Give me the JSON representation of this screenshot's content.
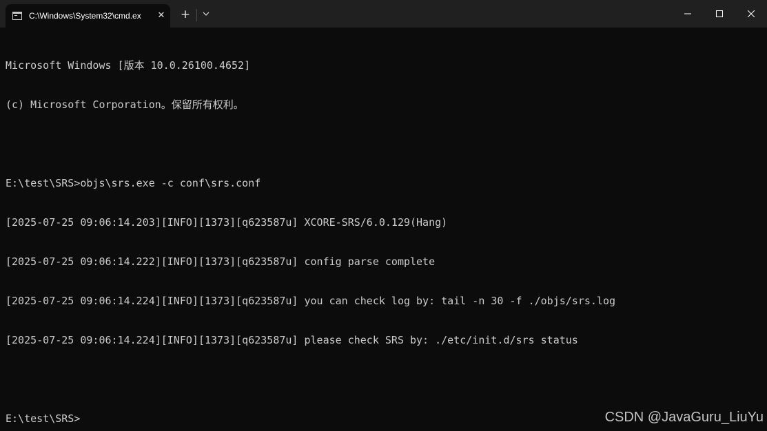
{
  "window": {
    "tab_title": "C:\\Windows\\System32\\cmd.ex",
    "tab_close_glyph": "✕",
    "new_tab_glyph": "+"
  },
  "icons": {
    "tab": "cmd-console-icon",
    "close_tab": "close-icon",
    "new_tab": "plus-icon",
    "dropdown": "chevron-down-icon",
    "minimize": "minimize-icon",
    "maximize": "maximize-icon",
    "close_window": "close-icon"
  },
  "colors": {
    "background": "#0c0c0c",
    "titlebar": "#202020",
    "text": "#cccccc"
  },
  "console": {
    "lines": [
      "Microsoft Windows [版本 10.0.26100.4652]",
      "(c) Microsoft Corporation。保留所有权利。",
      "",
      "E:\\test\\SRS>objs\\srs.exe -c conf\\srs.conf",
      "[2025-07-25 09:06:14.203][INFO][1373][q623587u] XCORE-SRS/6.0.129(Hang)",
      "[2025-07-25 09:06:14.222][INFO][1373][q623587u] config parse complete",
      "[2025-07-25 09:06:14.224][INFO][1373][q623587u] you can check log by: tail -n 30 -f ./objs/srs.log",
      "[2025-07-25 09:06:14.224][INFO][1373][q623587u] please check SRS by: ./etc/init.d/srs status",
      "",
      "E:\\test\\SRS>"
    ]
  },
  "watermark": "CSDN @JavaGuru_LiuYu"
}
